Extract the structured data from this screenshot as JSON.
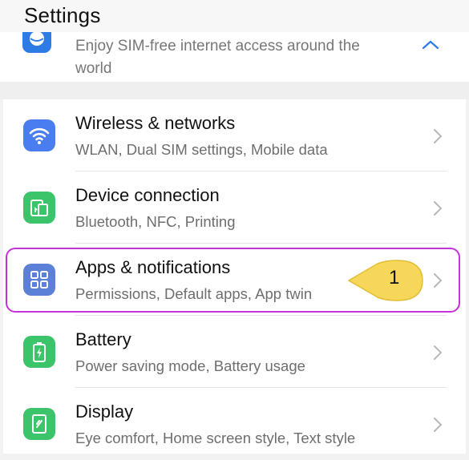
{
  "header": {
    "title": "Settings"
  },
  "banner": {
    "text": "Enjoy SIM-free internet access around the world",
    "icon": "globe-icon",
    "chevron": "chevron-up-icon"
  },
  "items": [
    {
      "label": "Wireless & networks",
      "sub": "WLAN, Dual SIM settings, Mobile data",
      "icon": "wifi-icon",
      "color": "#4a7ef0"
    },
    {
      "label": "Device connection",
      "sub": "Bluetooth, NFC, Printing",
      "icon": "device-connection-icon",
      "color": "#3cc46a"
    },
    {
      "label": "Apps & notifications",
      "sub": "Permissions, Default apps, App twin",
      "icon": "apps-grid-icon",
      "color": "#5c7fd8"
    },
    {
      "label": "Battery",
      "sub": "Power saving mode, Battery usage",
      "icon": "battery-icon",
      "color": "#3cc46a"
    },
    {
      "label": "Display",
      "sub": "Eye comfort, Home screen style, Text style",
      "icon": "display-icon",
      "color": "#3cc46a"
    }
  ],
  "annotation": {
    "step": "1",
    "highlight_color": "#c532d6",
    "callout_color": "#f6d75a"
  }
}
